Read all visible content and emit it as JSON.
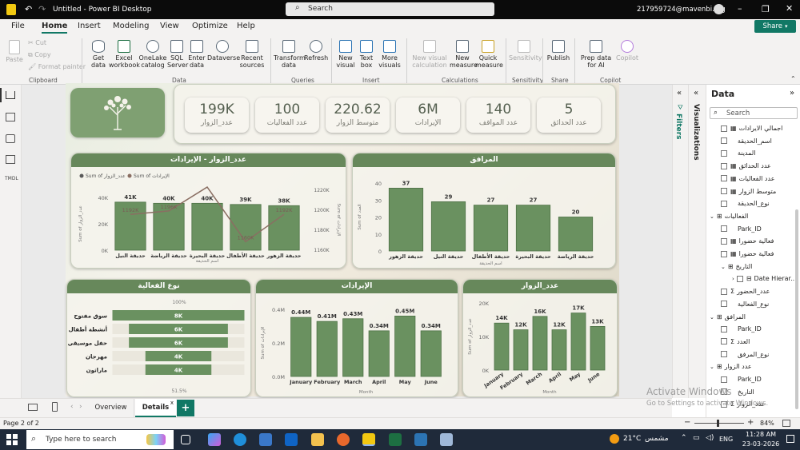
{
  "titlebar": {
    "app_title": "Untitled - Power BI Desktop",
    "search_placeholder": "Search",
    "account": "217959724@mavenbi.org"
  },
  "menu": {
    "file": "File",
    "home": "Home",
    "insert": "Insert",
    "modeling": "Modeling",
    "view": "View",
    "optimize": "Optimize",
    "help": "Help",
    "share": "Share"
  },
  "ribbon": {
    "paste": "Paste",
    "cut": "Cut",
    "copy": "Copy",
    "format_painter": "Format painter",
    "clipboard": "Clipboard",
    "get_data": "Get data",
    "excel": "Excel workbook",
    "onelake": "OneLake catalog",
    "sql": "SQL Server",
    "enter_data": "Enter data",
    "dataverse": "Dataverse",
    "recent": "Recent sources",
    "data_group": "Data",
    "transform": "Transform data",
    "refresh": "Refresh",
    "queries": "Queries",
    "new_visual": "New visual",
    "text_box": "Text box",
    "more_visuals": "More visuals",
    "insert_group": "Insert",
    "new_visual_calc": "New visual calculation",
    "new_measure": "New measure",
    "quick_measure": "Quick measure",
    "calculations": "Calculations",
    "sensitivity": "Sensitivity",
    "sensitivity_group": "Sensitivity",
    "publish": "Publish",
    "share_group": "Share",
    "prep_ai": "Prep data for AI",
    "copilot": "Copilot",
    "copilot_group": "Copilot"
  },
  "kpis": [
    {
      "value": "199K",
      "label": "عدد_الزوار"
    },
    {
      "value": "100",
      "label": "عدد الفعاليات"
    },
    {
      "value": "220.62",
      "label": "متوسط الزوار"
    },
    {
      "value": "6M",
      "label": "الإيرادات"
    },
    {
      "value": "140",
      "label": "عدد المواقف"
    },
    {
      "value": "5",
      "label": "عدد الحدائق"
    }
  ],
  "chart_data": [
    {
      "type": "bar",
      "title": "عدد_الزوار - الإيرادات",
      "legend": [
        "Sum of عدد_الزوار",
        "Sum of الإيرادات"
      ],
      "categories": [
        "حديقة النيل",
        "حديقة الرياضة",
        "حديقة البحيرة",
        "حديقة الأطفال",
        "حديقة الزهور"
      ],
      "series": [
        {
          "name": "Sum of عدد_الزوار",
          "values": [
            41000,
            40000,
            40000,
            39000,
            38000
          ],
          "labels": [
            "41K",
            "40K",
            "40K",
            "39K",
            "38K"
          ]
        },
        {
          "name": "Sum of الإيرادات",
          "values": [
            1192000,
            1196000,
            1224000,
            1160000,
            1192000
          ],
          "labels": [
            "1192K",
            "1196K",
            "",
            "1160K",
            "1192K"
          ]
        }
      ],
      "xlabel": "اسم الحديقة",
      "ylabel": "Sum of عدد_الزوار",
      "y2label": "Sum of الإيرادات",
      "yticks": [
        "40K",
        "20K",
        "0K"
      ],
      "y2ticks": [
        "1220K",
        "1200K",
        "1180K",
        "1160K"
      ],
      "ylim": [
        0,
        45000
      ],
      "y2lim": [
        1150000,
        1225000
      ]
    },
    {
      "type": "bar",
      "title": "المرافق",
      "categories": [
        "حديقة الزهور",
        "حديقة النيل",
        "حديقة الأطفال",
        "حديقة البحيرة",
        "حديقة الرياضة"
      ],
      "values": [
        37,
        29,
        27,
        27,
        20
      ],
      "xlabel": "اسم الحديقة",
      "ylabel": "Sum of العدد",
      "yticks": [
        "40",
        "30",
        "20",
        "10",
        "0"
      ],
      "ylim": [
        0,
        40
      ]
    },
    {
      "type": "bar",
      "title": "نوع الفعالية",
      "categories": [
        "سوق مفتوح",
        "أنشطة أطفال",
        "حفل موسيقي",
        "مهرجان",
        "ماراثون"
      ],
      "values": [
        8000,
        6000,
        6000,
        4000,
        4000
      ],
      "labels": [
        "8K",
        "6K",
        "6K",
        "4K",
        "4K"
      ],
      "top_label": "100%",
      "bottom_label": "51.5%"
    },
    {
      "type": "bar",
      "title": "الإيرادات",
      "categories": [
        "January",
        "February",
        "March",
        "April",
        "May",
        "June"
      ],
      "values": [
        0.44,
        0.41,
        0.43,
        0.34,
        0.45,
        0.34
      ],
      "labels": [
        "0.44M",
        "0.41M",
        "0.43M",
        "0.34M",
        "0.45M",
        "0.34M"
      ],
      "xlabel": "Month",
      "ylabel": "Sum of الإيرادات",
      "yticks": [
        "0.4M",
        "0.2M",
        "0.0M"
      ],
      "ylim": [
        0,
        0.5
      ]
    },
    {
      "type": "bar",
      "title": "عدد_الزوار",
      "categories": [
        "January",
        "February",
        "March",
        "April",
        "May",
        "June"
      ],
      "values": [
        14,
        12,
        16,
        12,
        17,
        13
      ],
      "labels": [
        "14K",
        "12K",
        "16K",
        "12K",
        "17K",
        "13K"
      ],
      "xlabel": "Month",
      "ylabel": "Sum of عدد_الزوار",
      "yticks": [
        "20K",
        "10K",
        "0K"
      ],
      "ylim": [
        0,
        20
      ]
    }
  ],
  "panes": {
    "filters": "Filters",
    "visualizations": "Visualizations",
    "data_title": "Data",
    "data_search": "Search"
  },
  "fields": [
    {
      "name": "اجمالي الايرادات",
      "indent": 2,
      "kind": "measure"
    },
    {
      "name": "اسم_الحديقة",
      "indent": 2,
      "kind": "field"
    },
    {
      "name": "المدينة",
      "indent": 2,
      "kind": "field"
    },
    {
      "name": "عدد الحدائق",
      "indent": 2,
      "kind": "measure"
    },
    {
      "name": "عدد الفعاليات",
      "indent": 2,
      "kind": "measure"
    },
    {
      "name": "متوسط الزوار",
      "indent": 2,
      "kind": "measure"
    },
    {
      "name": "نوع_الحديقة",
      "indent": 2,
      "kind": "field"
    },
    {
      "name": "الفعاليات",
      "indent": 1,
      "kind": "table"
    },
    {
      "name": "Park_ID",
      "indent": 2,
      "kind": "field"
    },
    {
      "name": "فعالية حضورا",
      "indent": 2,
      "kind": "measure"
    },
    {
      "name": "فعالية حضورا",
      "indent": 2,
      "kind": "measure"
    },
    {
      "name": "التاريخ",
      "indent": 2,
      "kind": "table"
    },
    {
      "name": "Date Hierar...",
      "indent": 3,
      "kind": "hier"
    },
    {
      "name": "عدد_الحضور",
      "indent": 2,
      "kind": "sum"
    },
    {
      "name": "نوع_الفعالية",
      "indent": 2,
      "kind": "field"
    },
    {
      "name": "المرافق",
      "indent": 1,
      "kind": "table"
    },
    {
      "name": "Park_ID",
      "indent": 2,
      "kind": "field"
    },
    {
      "name": "العدد",
      "indent": 2,
      "kind": "sum"
    },
    {
      "name": "نوع_المرفق",
      "indent": 2,
      "kind": "field"
    },
    {
      "name": "عدد الزوار",
      "indent": 1,
      "kind": "table"
    },
    {
      "name": "Park_ID",
      "indent": 2,
      "kind": "field"
    },
    {
      "name": "التاريخ",
      "indent": 2,
      "kind": "field"
    },
    {
      "name": "عدد_الزوار",
      "indent": 2,
      "kind": "sum"
    }
  ],
  "tabs": {
    "overview": "Overview",
    "details": "Details",
    "add": "+"
  },
  "status": {
    "page": "Page 2 of 2",
    "zoom": "84%"
  },
  "watermark": {
    "line1": "Activate Windows",
    "line2": "Go to Settings to activate Windows."
  },
  "taskbar": {
    "search_placeholder": "Type here to search",
    "weather": "21°C",
    "weather_desc": "مشمس",
    "lang": "ENG",
    "time": "11:28 AM",
    "date": "23-03-2026"
  },
  "colors": {
    "bar": "#6a9160",
    "bar_stroke": "#4e7246",
    "header": "#67885b",
    "line": "#8a6e62"
  }
}
